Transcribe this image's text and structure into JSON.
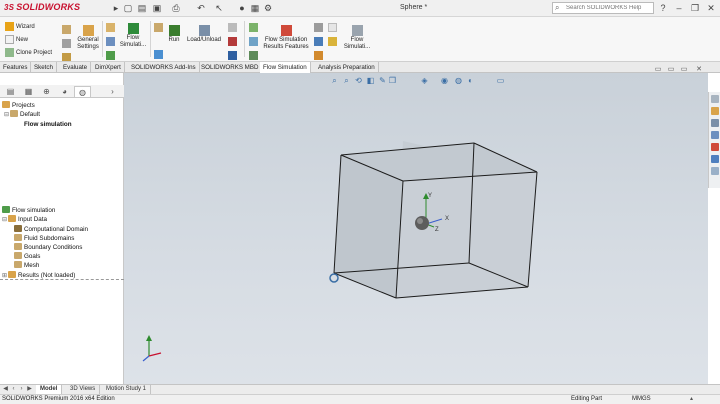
{
  "app": {
    "brand": "SOLIDWORKS",
    "brand_prefix": "3S",
    "document_title": "Sphere *",
    "search_placeholder": "Search SOLIDWORKS Help"
  },
  "ribbon": {
    "wizard": "Wizard",
    "new": "New",
    "clone_project": "Clone Project",
    "general_settings_1": "General",
    "general_settings_2": "Settings",
    "flow_simulation_1": "Flow",
    "flow_simulation_2": "Simulati...",
    "run": "Run",
    "load_unload": "Load/Unload",
    "results_features_1": "Flow Simulation",
    "results_features_2": "Results Features",
    "flow_sim2_1": "Flow",
    "flow_sim2_2": "Simulati..."
  },
  "tabs": [
    "Features",
    "Sketch",
    "Evaluate",
    "DimXpert",
    "SOLIDWORKS Add-Ins",
    "SOLIDWORKS MBD",
    "Flow Simulation",
    "Analysis Preparation"
  ],
  "active_tab": "Flow Simulation",
  "project_tree": {
    "projects": "Projects",
    "default": "Default",
    "flow_simulation": "Flow simulation"
  },
  "analysis_tree": {
    "root": "Flow simulation",
    "input_data": "Input Data",
    "computational_domain": "Computational Domain",
    "fluid_subdomains": "Fluid Subdomains",
    "boundary_conditions": "Boundary Conditions",
    "goals": "Goals",
    "mesh": "Mesh",
    "results": "Results (Not loaded)"
  },
  "bottom_tabs": [
    "Model",
    "3D Views",
    "Motion Study 1"
  ],
  "active_bottom_tab": "Model",
  "status": {
    "edition": "SOLIDWORKS Premium 2016 x64 Edition",
    "mode": "Editing Part",
    "units": "MMGS"
  },
  "colors": {
    "brand_red": "#c8102e",
    "viewport_bg": "#d3d9df",
    "cube_face": "#c4ccd3"
  }
}
